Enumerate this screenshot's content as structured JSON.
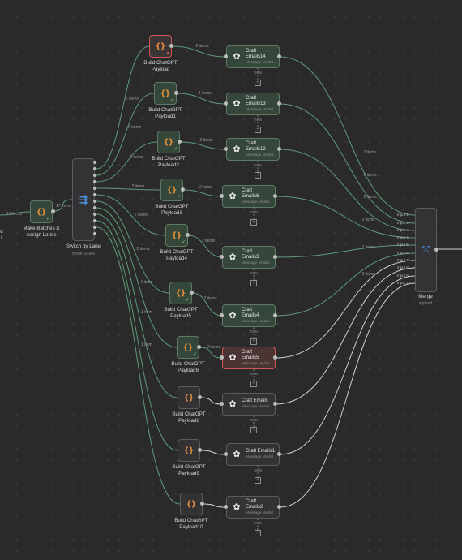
{
  "colors": {
    "ok_wire": "#5e9b76",
    "plain_wire": "#cfcfcf",
    "error": "#d05555",
    "code": "#ff9a3c",
    "switch_icon": "#4e8ed8"
  },
  "left_edge": {
    "text_a": "d",
    "text_b": "t"
  },
  "make_batches": {
    "label": "Make Batches &\nAssign Lanes",
    "in_items": "17 items",
    "out_items": "17 items"
  },
  "switch": {
    "label": "Switch by Lane",
    "mode": "mode: Rules"
  },
  "merge": {
    "label": "Merge",
    "mode": "append",
    "inputs": [
      "Input 1",
      "Input 2",
      "Input 3",
      "Input 4",
      "Input 5",
      "Input 6",
      "Input 7",
      "Input 8",
      "Input 9",
      "Input 10"
    ]
  },
  "payloads": [
    {
      "label": "Build ChatGPT\nPayload",
      "items": "2 items",
      "status": "error"
    },
    {
      "label": "Build ChatGPT\nPayload1",
      "items": "2 items",
      "status": "ok"
    },
    {
      "label": "Build ChatGPT\nPayload2",
      "items": "2 items",
      "status": "ok"
    },
    {
      "label": "Build ChatGPT\nPayload3",
      "items": "2 items",
      "status": "ok"
    },
    {
      "label": "Build ChatGPT\nPayload4",
      "items": "2 items",
      "status": "ok"
    },
    {
      "label": "Build ChatGPT\nPayload5",
      "items": "2 items",
      "status": "ok"
    },
    {
      "label": "Build ChatGPT\nPayload6",
      "items": "2 items",
      "status": "ok"
    },
    {
      "label": "Build ChatGPT\nPayload8",
      "items": "",
      "status": "plain"
    },
    {
      "label": "Build ChatGPT\nPayload9",
      "items": "",
      "status": "plain"
    },
    {
      "label": "Build ChatGPT\nPayload10",
      "items": "",
      "status": "plain"
    }
  ],
  "switch_items": [
    "2 items",
    "2 items",
    "2 items",
    "2 items",
    "2 items",
    "2 items",
    "1 item",
    "1 item",
    "1 item"
  ],
  "agents": [
    {
      "title": "Craft\nEmails14",
      "sub": "Message Model...",
      "status": "ok",
      "out_items": "2 items"
    },
    {
      "title": "Craft\nEmails13",
      "sub": "Message Model...",
      "status": "ok",
      "out_items": "2 items"
    },
    {
      "title": "Craft\nEmails12",
      "sub": "Message Model...",
      "status": "ok",
      "out_items": "2 items"
    },
    {
      "title": "Craft\nEmails6",
      "sub": "Message Model...",
      "status": "ok",
      "out_items": "2 items"
    },
    {
      "title": "Craft\nEmails3",
      "sub": "Message Model...",
      "status": "ok",
      "out_items": "2 items"
    },
    {
      "title": "Craft\nEmails4",
      "sub": "Message Model...",
      "status": "ok",
      "out_items": "2 items"
    },
    {
      "title": "Craft\nEmails5",
      "sub": "Message Model",
      "status": "error",
      "out_items": ""
    },
    {
      "title": "Craft Emails",
      "sub": "Message Model",
      "status": "plain",
      "out_items": ""
    },
    {
      "title": "Craft Emails1",
      "sub": "Message Model",
      "status": "plain",
      "out_items": ""
    },
    {
      "title": "Craft\nEmails2",
      "sub": "Message Model",
      "status": "plain",
      "out_items": ""
    }
  ],
  "tools_label": "Tools",
  "icons": {
    "code": "code-braces-icon",
    "agent": "openai-icon",
    "switch": "switch-route-icon",
    "merge": "merge-icon",
    "check": "check-icon",
    "warning": "warning-icon",
    "plus": "plus-icon"
  }
}
